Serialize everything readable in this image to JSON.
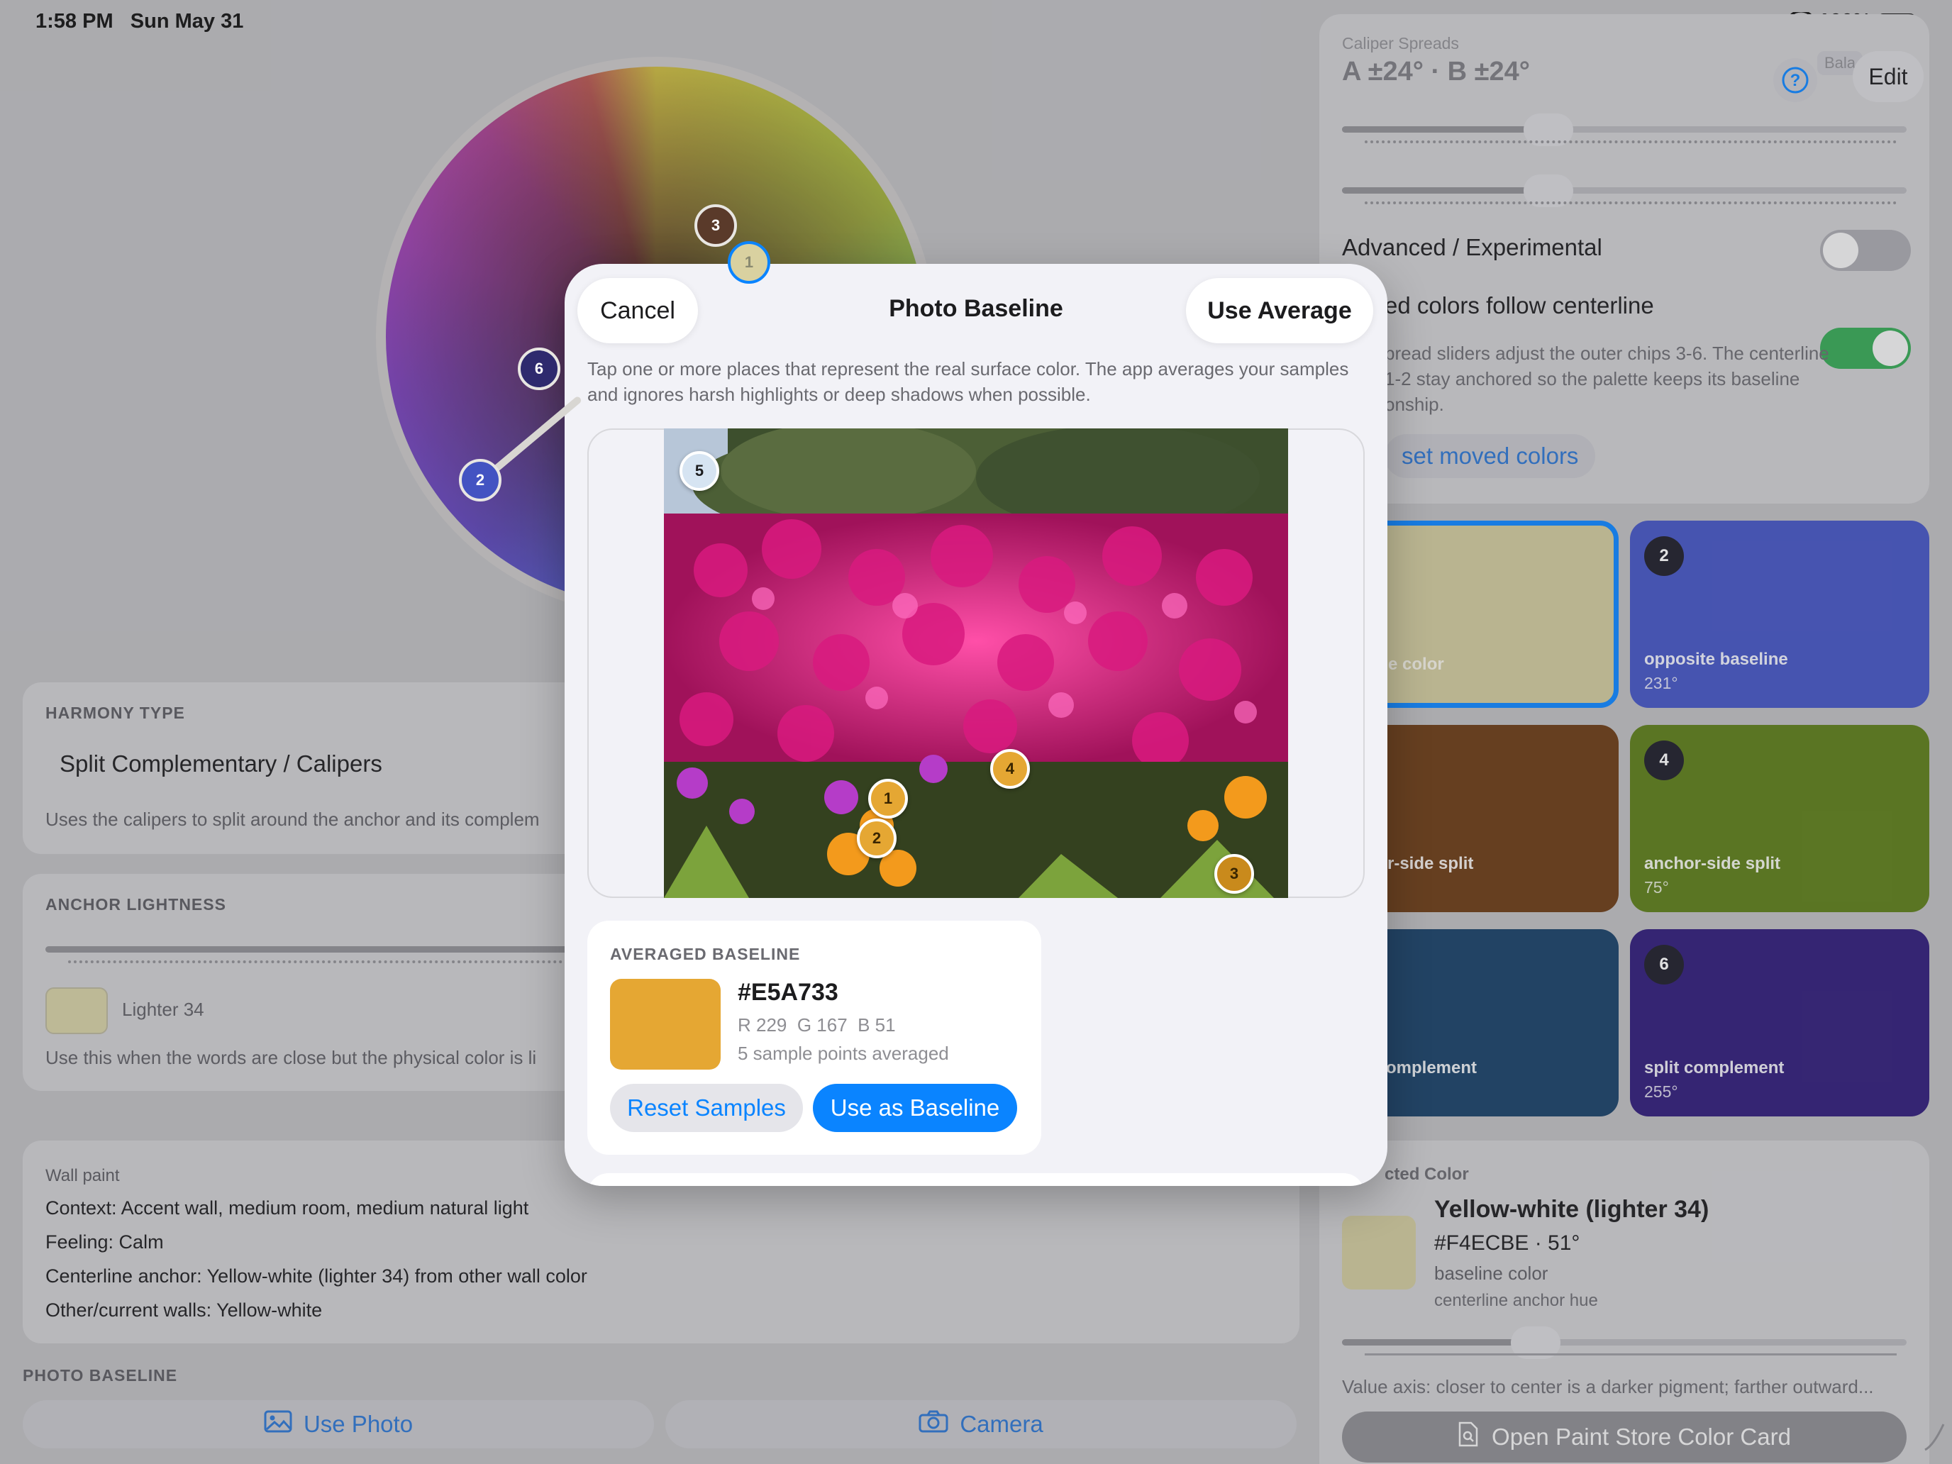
{
  "status": {
    "time": "1:58 PM",
    "date": "Sun May 31",
    "battery": "100%"
  },
  "colors": {
    "accent": "#0a84ff",
    "swatch_avg": "#E5A733",
    "anchor_swatch": "#d4cfa3",
    "tile1": "#cfc89b",
    "tile2": "#4353c2",
    "tile3": "#6a3a13",
    "tile4": "#5b7c17",
    "tile5": "#173f66",
    "tile6": "#2e1a78"
  },
  "wheel": {
    "chips": [
      "3",
      "1",
      "6",
      "2"
    ]
  },
  "harmony": {
    "title": "HARMONY TYPE",
    "value": "Split Complementary / Calipers",
    "description": "Uses the calipers to split around the anchor and its complem"
  },
  "anchor": {
    "title": "ANCHOR LIGHTNESS",
    "swatch_label": "Lighter 34",
    "description": "Use this when the words are close but the physical color is li"
  },
  "notes": {
    "title": "Wall paint",
    "lines": [
      "Context: Accent wall, medium room, medium natural light",
      "Feeling: Calm",
      "Centerline anchor: Yellow-white (lighter 34) from other wall color",
      "Other/current walls: Yellow-white"
    ]
  },
  "photo_baseline": {
    "title": "PHOTO BASELINE",
    "use_photo": "Use Photo",
    "camera": "Camera"
  },
  "right": {
    "caliper_label": "Caliper Spreads",
    "caliper_value": "A ±24° · B ±24°",
    "bala": "Bala",
    "edit": "Edit",
    "advanced": "Advanced / Experimental",
    "follow": "ed colors follow centerline",
    "description": "pread sliders adjust the outer chips 3-6. The centerline\n 1-2 stay anchored so the palette keeps its baseline\nonship.",
    "reset_moved": "set moved colors"
  },
  "tiles": [
    {
      "num": "",
      "label": "e color",
      "deg": ""
    },
    {
      "num": "2",
      "label": "opposite baseline",
      "deg": "231°"
    },
    {
      "num": "",
      "label": "r-side split",
      "deg": ""
    },
    {
      "num": "4",
      "label": "anchor-side split",
      "deg": "75°"
    },
    {
      "num": "",
      "label": "omplement",
      "deg": ""
    },
    {
      "num": "6",
      "label": "split complement",
      "deg": "255°"
    }
  ],
  "selected": {
    "title": "cted Color",
    "name": "Yellow-white (lighter 34)",
    "hex_deg": "#F4ECBE · 51°",
    "role1": "baseline color",
    "role2": "centerline anchor hue",
    "value_axis": "Value axis: closer to center is a darker pigment; farther outward...",
    "open_card": "Open Paint Store Color Card"
  },
  "modal": {
    "cancel": "Cancel",
    "title": "Photo Baseline",
    "use_average": "Use Average",
    "instructions": "Tap one or more places that represent the real surface color. The app averages your samples and ignores harsh highlights or deep shadows when possible.",
    "samples": [
      "5",
      "1",
      "2",
      "4",
      "3"
    ],
    "avg_title": "AVERAGED BASELINE",
    "avg_hex": "#E5A733",
    "avg_rgb": "R 229  G 167  B 51",
    "avg_count": "5 sample points averaged",
    "reset": "Reset Samples",
    "use_baseline": "Use as Baseline"
  }
}
